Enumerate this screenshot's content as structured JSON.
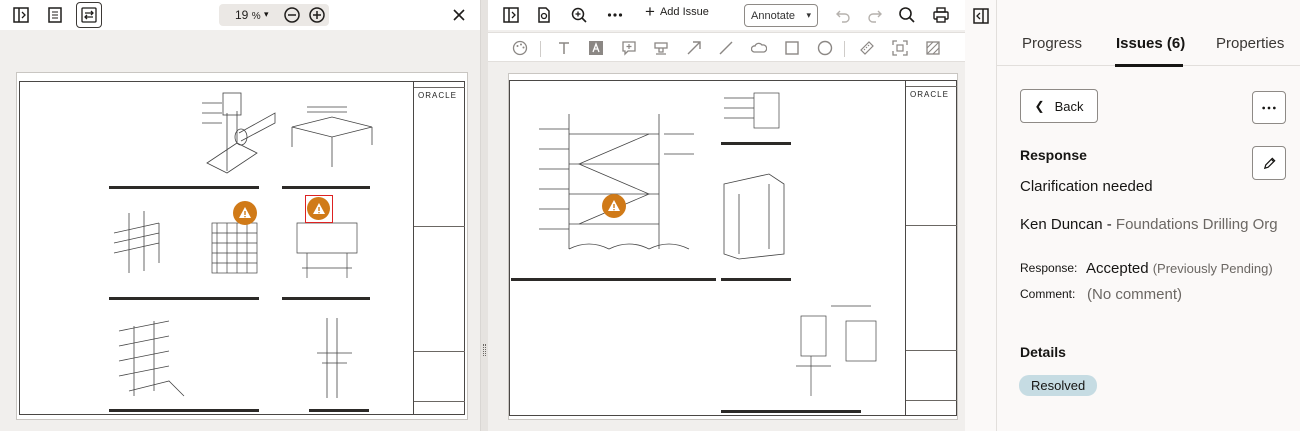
{
  "left_viewer": {
    "zoom_value": "19",
    "zoom_unit": "%",
    "brand_text": "ORACLE"
  },
  "mid_viewer": {
    "add_issue_label": "Add Issue",
    "annotate_select": "Annotate",
    "brand_text": "ORACLE"
  },
  "panel": {
    "tabs": [
      {
        "label": "Progress"
      },
      {
        "label": "Issues (6)"
      },
      {
        "label": "Properties"
      }
    ],
    "back_label": "Back",
    "response_heading": "Response",
    "response_value": "Clarification needed",
    "author_name": "Ken Duncan",
    "author_sep": " - ",
    "author_org": "Foundations Drilling Org",
    "response_label": "Response:",
    "response_status": "Accepted",
    "response_prev": "(Previously Pending)",
    "comment_label": "Comment:",
    "comment_value": "(No comment)",
    "details_heading": "Details",
    "status_badge": "Resolved"
  },
  "colors": {
    "accent_orange": "#d07a18",
    "badge_bg": "#c6dce3",
    "selection_red": "#dd2222"
  }
}
